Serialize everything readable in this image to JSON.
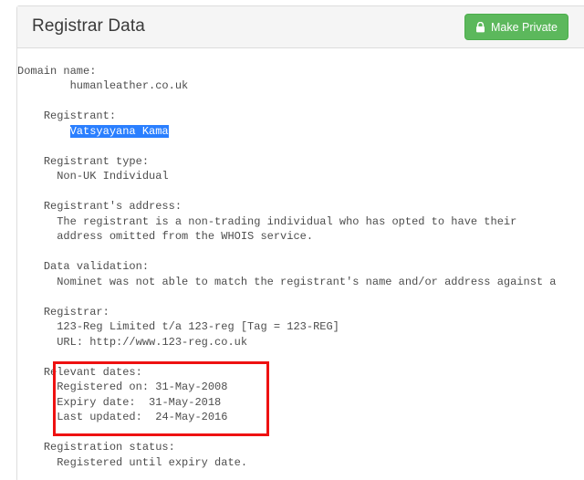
{
  "panel": {
    "title": "Registrar Data",
    "make_private_button": {
      "label": "Make Private",
      "icon": "lock-icon",
      "color": "#5cb85c"
    }
  },
  "whois": {
    "domain_name": {
      "label": "Domain name:",
      "value": "humanleather.co.uk"
    },
    "registrant": {
      "label": "Registrant:",
      "value": "Vatsyayana Kama",
      "selected": true,
      "selection_color": "#2a7fff"
    },
    "registrant_type": {
      "label": "Registrant type:",
      "value": "Non-UK Individual"
    },
    "registrant_address": {
      "label": "Registrant's address:",
      "lines": [
        "The registrant is a non-trading individual who has opted to have their",
        "address omitted from the WHOIS service."
      ]
    },
    "data_validation": {
      "label": "Data validation:",
      "lines": [
        "Nominet was not able to match the registrant's name and/or address against a"
      ]
    },
    "registrar": {
      "label": "Registrar:",
      "lines": [
        "123-Reg Limited t/a 123-reg [Tag = 123-REG]",
        "URL: http://www.123-reg.co.uk"
      ]
    },
    "relevant_dates": {
      "label": "Relevant dates:",
      "registered_on": "Registered on: 31-May-2008",
      "expiry_date": "Expiry date:  31-May-2018",
      "last_updated": "Last updated:  24-May-2016"
    },
    "registration_status": {
      "label": "Registration status:",
      "value": "Registered until expiry date."
    }
  },
  "annotation": {
    "highlight_box_color": "#ee1111"
  }
}
